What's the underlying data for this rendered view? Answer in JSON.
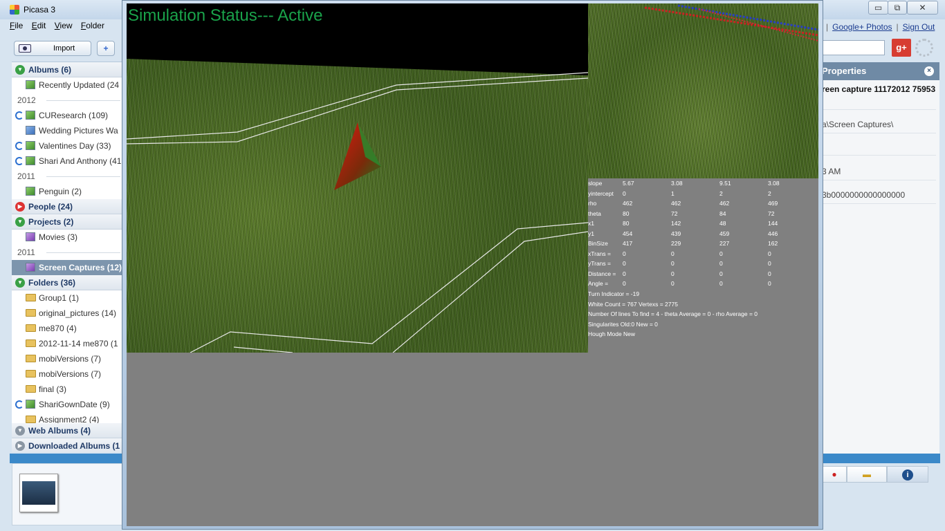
{
  "picasa": {
    "window_title": "Picasa 3",
    "menu": [
      "File",
      "Edit",
      "View",
      "Folder"
    ],
    "import_label": "Import",
    "add_label": "+",
    "sections": {
      "albums": "Albums (6)",
      "people": "People (24)",
      "projects": "Projects (2)",
      "folders": "Folders (36)",
      "web_albums": "Web Albums (4)",
      "downloaded": "Downloaded Albums (1"
    },
    "years": [
      "2012",
      "2011",
      "2011"
    ],
    "albums": [
      {
        "label": "Recently Updated (24"
      },
      {
        "label": "CUResearch (109)"
      },
      {
        "label": "Wedding Pictures Wa"
      },
      {
        "label": "Valentines Day (33)"
      },
      {
        "label": "Shari And Anthony (41"
      },
      {
        "label": "Penguin (2)"
      }
    ],
    "projects": [
      {
        "label": "Movies (3)"
      },
      {
        "label": "Screen Captures (12)"
      }
    ],
    "folders": [
      {
        "label": "Group1 (1)"
      },
      {
        "label": "original_pictures (14)"
      },
      {
        "label": "me870 (4)"
      },
      {
        "label": "2012-11-14 me870 (1"
      },
      {
        "label": "mobiVersions (7)"
      },
      {
        "label": "mobiVersions (7)"
      },
      {
        "label": "final (3)"
      },
      {
        "label": "ShariGownDate (9)"
      },
      {
        "label": "Assignment2 (4)"
      }
    ],
    "links": {
      "google_photos": "Google+ Photos",
      "separator": "|",
      "sign_out": "Sign Out"
    },
    "gplus": "g+",
    "properties": {
      "header": "Properties",
      "close": "×",
      "lines": [
        "reen capture 11172012 75953",
        "a\\Screen Captures\\",
        "3 AM",
        "3b0000000000000000"
      ]
    },
    "info_icon": "i"
  },
  "sim": {
    "status": "Simulation Status--- Active",
    "table": {
      "rows": [
        {
          "label": "slope",
          "v1": "5.67",
          "v2": "3.08",
          "v3": "9.51",
          "v4": "3.08"
        },
        {
          "label": "yintercept",
          "v1": "0",
          "v2": "1",
          "v3": "2",
          "v4": "2"
        },
        {
          "label": "rho",
          "v1": "462",
          "v2": "462",
          "v3": "462",
          "v4": "469"
        },
        {
          "label": "theta",
          "v1": "80",
          "v2": "72",
          "v3": "84",
          "v4": "72"
        },
        {
          "label": "x1",
          "v1": "80",
          "v2": "142",
          "v3": "48",
          "v4": "144"
        },
        {
          "label": "y1",
          "v1": "454",
          "v2": "439",
          "v3": "459",
          "v4": "446"
        },
        {
          "label": "BinSize",
          "v1": "417",
          "v2": "229",
          "v3": "227",
          "v4": "162"
        },
        {
          "label": "xTrans =",
          "v1": "0",
          "v2": "0",
          "v3": "0",
          "v4": "0"
        },
        {
          "label": "yTrans =",
          "v1": "0",
          "v2": "0",
          "v3": "0",
          "v4": "0"
        },
        {
          "label": "Distance =",
          "v1": "0",
          "v2": "0",
          "v3": "0",
          "v4": "0"
        },
        {
          "label": "Angle =",
          "v1": "0",
          "v2": "0",
          "v3": "0",
          "v4": "0"
        }
      ]
    },
    "lines": [
      "Turn Indicator = -19",
      "White Count = 767 Vertexs = 2775",
      "Number Of lines To find = 4 -  theta Average = 0  - rho Average = 0",
      "Singularites Old:0 New = 0",
      "Hough Mode New"
    ]
  }
}
